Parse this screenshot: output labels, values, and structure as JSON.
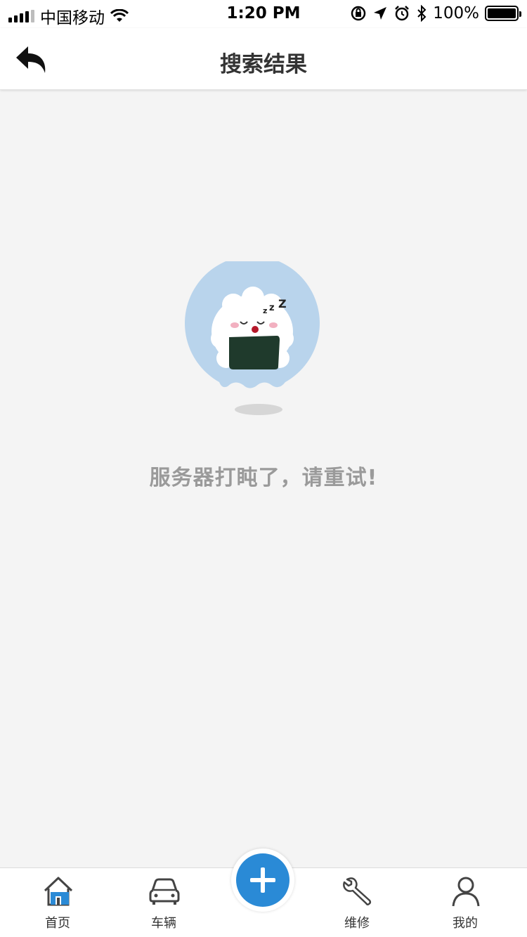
{
  "status_bar": {
    "carrier": "中国移动",
    "time": "1:20 PM",
    "battery": "100%"
  },
  "nav": {
    "title": "搜索结果"
  },
  "main": {
    "message": "服务器打盹了，请重试!"
  },
  "tabs": [
    {
      "label": "首页",
      "icon": "home-icon",
      "active": true
    },
    {
      "label": "车辆",
      "icon": "car-icon"
    },
    {
      "label": "维修",
      "icon": "wrench-icon"
    },
    {
      "label": "我的",
      "icon": "user-icon"
    }
  ],
  "colors": {
    "accent": "#2a8ad6",
    "background": "#f4f4f4",
    "illustration_circle": "#b9d4ec",
    "message_text": "#9a9a9a"
  }
}
